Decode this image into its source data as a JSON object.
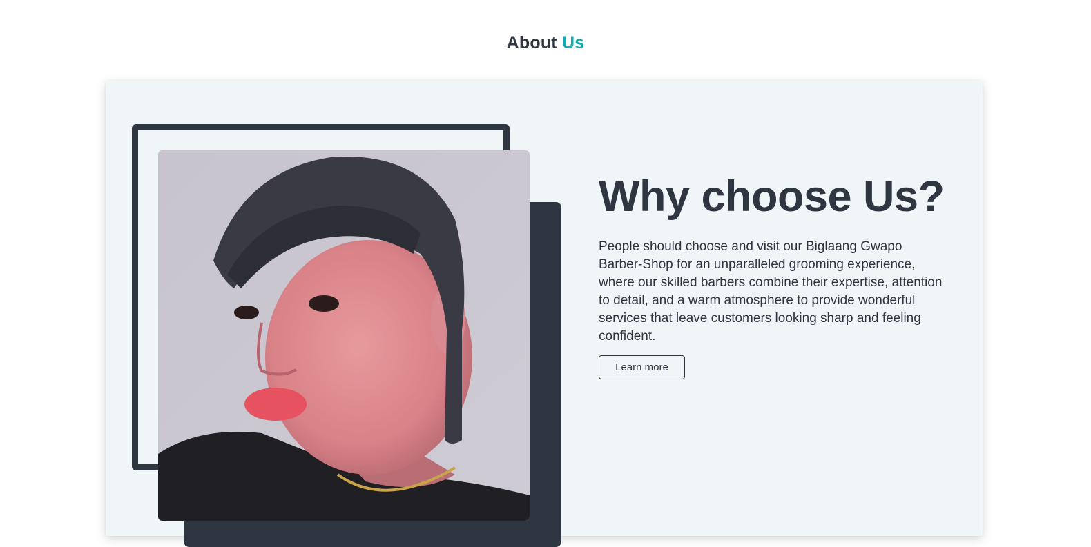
{
  "heading": {
    "part1": "About ",
    "part2": "Us",
    "accent_color": "#14a9b3"
  },
  "about": {
    "title": "Why choose Us?",
    "description": "People should choose and visit our Biglaang Gwapo Barber-Shop for an unparalleled grooming experience, where our skilled barbers combine their expertise, attention to detail, and a warm atmosphere to provide wonderful services that leave customers looking sharp and feeling confident.",
    "button_label": "Learn more"
  },
  "colors": {
    "dark": "#2d3641",
    "card_background": "#f0f5f8",
    "accent": "#14a9b3"
  }
}
